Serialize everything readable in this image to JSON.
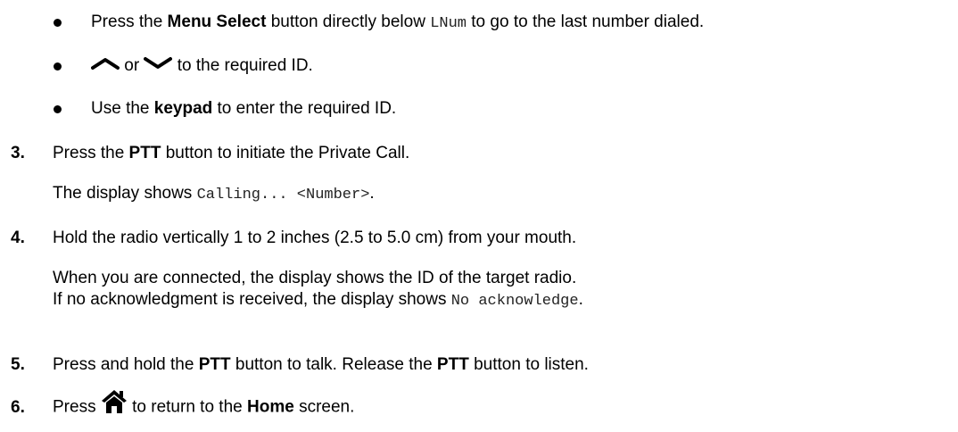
{
  "bullets": [
    {
      "pre": "Press the ",
      "bold": "Menu Select",
      "mid": " button directly below ",
      "code": "LNum",
      "post": " to go to the last number dialed."
    },
    {
      "icon_up": "chevron-up-icon",
      "or": " or ",
      "icon_down": "chevron-down-icon",
      "post": " to the required ID."
    },
    {
      "pre": "Use the ",
      "bold": "keypad",
      "post": " to enter the required ID."
    }
  ],
  "steps": [
    {
      "num": "3.",
      "line1": {
        "pre": "Press the ",
        "bold": "PTT",
        "post": " button to initiate the Private Call."
      },
      "line2": {
        "pre": "The display shows ",
        "code": "Calling... <Number>",
        "post": "."
      }
    },
    {
      "num": "4.",
      "line1": {
        "text": "Hold the radio vertically 1 to 2 inches (2.5 to 5.0 cm) from your mouth."
      },
      "line2": {
        "text": "When you are connected, the display shows the ID of the target radio."
      },
      "line3": {
        "pre": "If no acknowledgment is received, the display shows ",
        "code": "No acknowledge",
        "post": "."
      }
    },
    {
      "num": "5.",
      "line1": {
        "pre": "Press and hold the ",
        "bold1": "PTT",
        "mid": " button to talk. Release the ",
        "bold2": "PTT",
        "post": " button to listen."
      }
    },
    {
      "num": "6.",
      "line1": {
        "pre": "Press ",
        "icon": "home-icon",
        "mid": " to return to the ",
        "bold": "Home",
        "post": " screen."
      }
    }
  ]
}
